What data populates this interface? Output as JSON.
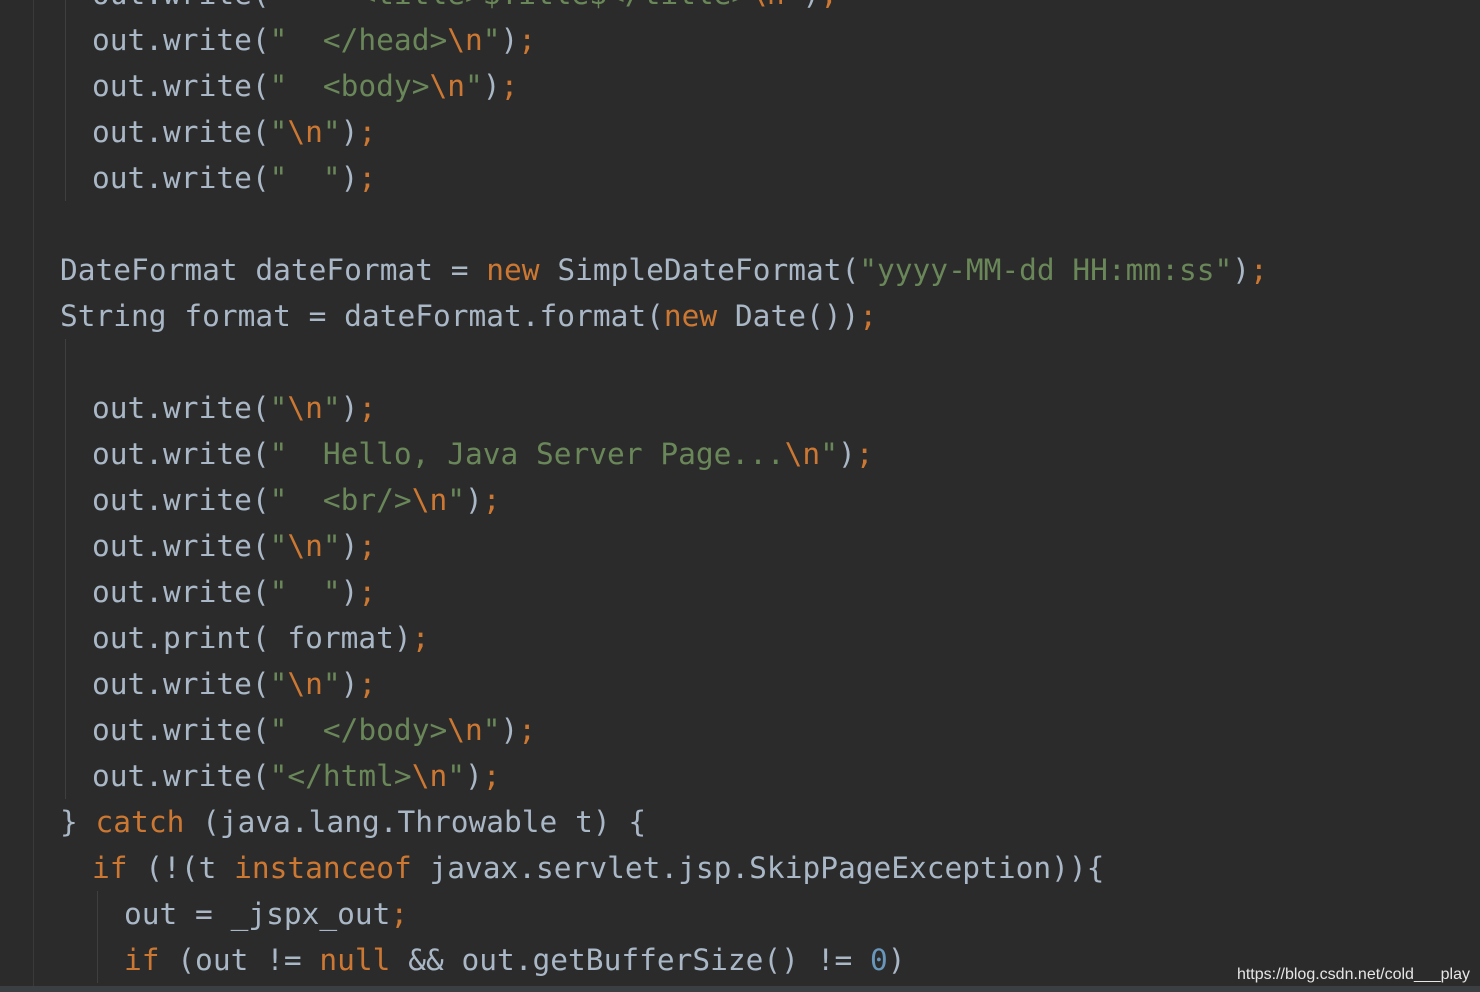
{
  "editor": {
    "colors": {
      "background": "#2b2b2b",
      "plain": "#a9b7c6",
      "keyword": "#cc7832",
      "string": "#6a8759",
      "number": "#6897bb"
    },
    "lines": [
      {
        "indent": 1,
        "tokens": [
          [
            "plain",
            "out.write("
          ],
          [
            "str",
            "\"    <title>$Title$</title>"
          ],
          [
            "esc",
            "\\n"
          ],
          [
            "str",
            "\""
          ],
          [
            "plain",
            ")"
          ],
          [
            "punc",
            ";"
          ]
        ]
      },
      {
        "indent": 1,
        "tokens": [
          [
            "plain",
            "out.write("
          ],
          [
            "str",
            "\"  </head>"
          ],
          [
            "esc",
            "\\n"
          ],
          [
            "str",
            "\""
          ],
          [
            "plain",
            ")"
          ],
          [
            "punc",
            ";"
          ]
        ]
      },
      {
        "indent": 1,
        "tokens": [
          [
            "plain",
            "out.write("
          ],
          [
            "str",
            "\"  <body>"
          ],
          [
            "esc",
            "\\n"
          ],
          [
            "str",
            "\""
          ],
          [
            "plain",
            ")"
          ],
          [
            "punc",
            ";"
          ]
        ]
      },
      {
        "indent": 1,
        "tokens": [
          [
            "plain",
            "out.write("
          ],
          [
            "str",
            "\""
          ],
          [
            "esc",
            "\\n"
          ],
          [
            "str",
            "\""
          ],
          [
            "plain",
            ")"
          ],
          [
            "punc",
            ";"
          ]
        ]
      },
      {
        "indent": 1,
        "tokens": [
          [
            "plain",
            "out.write("
          ],
          [
            "str",
            "\"  \""
          ],
          [
            "plain",
            ")"
          ],
          [
            "punc",
            ";"
          ]
        ]
      },
      {
        "indent": 0,
        "tokens": []
      },
      {
        "indent": 0,
        "tokens": [
          [
            "plain",
            "DateFormat dateFormat = "
          ],
          [
            "kw",
            "new"
          ],
          [
            "plain",
            " SimpleDateFormat("
          ],
          [
            "str",
            "\"yyyy-MM-dd HH:mm:ss\""
          ],
          [
            "plain",
            ")"
          ],
          [
            "punc",
            ";"
          ]
        ]
      },
      {
        "indent": 0,
        "tokens": [
          [
            "plain",
            "String format = dateFormat.format("
          ],
          [
            "kw",
            "new"
          ],
          [
            "plain",
            " Date())"
          ],
          [
            "punc",
            ";"
          ]
        ]
      },
      {
        "indent": 0,
        "tokens": []
      },
      {
        "indent": 1,
        "tokens": [
          [
            "plain",
            "out.write("
          ],
          [
            "str",
            "\""
          ],
          [
            "esc",
            "\\n"
          ],
          [
            "str",
            "\""
          ],
          [
            "plain",
            ")"
          ],
          [
            "punc",
            ";"
          ]
        ]
      },
      {
        "indent": 1,
        "tokens": [
          [
            "plain",
            "out.write("
          ],
          [
            "str",
            "\"  Hello, Java Server Page..."
          ],
          [
            "esc",
            "\\n"
          ],
          [
            "str",
            "\""
          ],
          [
            "plain",
            ")"
          ],
          [
            "punc",
            ";"
          ]
        ]
      },
      {
        "indent": 1,
        "tokens": [
          [
            "plain",
            "out.write("
          ],
          [
            "str",
            "\"  <br/>"
          ],
          [
            "esc",
            "\\n"
          ],
          [
            "str",
            "\""
          ],
          [
            "plain",
            ")"
          ],
          [
            "punc",
            ";"
          ]
        ]
      },
      {
        "indent": 1,
        "tokens": [
          [
            "plain",
            "out.write("
          ],
          [
            "str",
            "\""
          ],
          [
            "esc",
            "\\n"
          ],
          [
            "str",
            "\""
          ],
          [
            "plain",
            ")"
          ],
          [
            "punc",
            ";"
          ]
        ]
      },
      {
        "indent": 1,
        "tokens": [
          [
            "plain",
            "out.write("
          ],
          [
            "str",
            "\"  \""
          ],
          [
            "plain",
            ")"
          ],
          [
            "punc",
            ";"
          ]
        ]
      },
      {
        "indent": 1,
        "tokens": [
          [
            "plain",
            "out.print( format)"
          ],
          [
            "punc",
            ";"
          ]
        ]
      },
      {
        "indent": 1,
        "tokens": [
          [
            "plain",
            "out.write("
          ],
          [
            "str",
            "\""
          ],
          [
            "esc",
            "\\n"
          ],
          [
            "str",
            "\""
          ],
          [
            "plain",
            ")"
          ],
          [
            "punc",
            ";"
          ]
        ]
      },
      {
        "indent": 1,
        "tokens": [
          [
            "plain",
            "out.write("
          ],
          [
            "str",
            "\"  </body>"
          ],
          [
            "esc",
            "\\n"
          ],
          [
            "str",
            "\""
          ],
          [
            "plain",
            ")"
          ],
          [
            "punc",
            ";"
          ]
        ]
      },
      {
        "indent": 1,
        "tokens": [
          [
            "plain",
            "out.write("
          ],
          [
            "str",
            "\"</html>"
          ],
          [
            "esc",
            "\\n"
          ],
          [
            "str",
            "\""
          ],
          [
            "plain",
            ")"
          ],
          [
            "punc",
            ";"
          ]
        ]
      },
      {
        "indent": 0,
        "tokens": [
          [
            "plain",
            "} "
          ],
          [
            "kw",
            "catch"
          ],
          [
            "plain",
            " (java.lang.Throwable t) {"
          ]
        ]
      },
      {
        "indent": 1,
        "tokens": [
          [
            "kw",
            "if"
          ],
          [
            "plain",
            " (!(t "
          ],
          [
            "kw",
            "instanceof"
          ],
          [
            "plain",
            " javax.servlet.jsp.SkipPageException)){"
          ]
        ]
      },
      {
        "indent": 2,
        "tokens": [
          [
            "plain",
            "out = _jspx_out"
          ],
          [
            "punc",
            ";"
          ]
        ]
      },
      {
        "indent": 2,
        "tokens": [
          [
            "kw",
            "if"
          ],
          [
            "plain",
            " (out != "
          ],
          [
            "kw",
            "null"
          ],
          [
            "plain",
            " && out.getBufferSize() != "
          ],
          [
            "num",
            "0"
          ],
          [
            "plain",
            ")"
          ]
        ]
      }
    ]
  },
  "watermark": "https://blog.csdn.net/cold___play"
}
